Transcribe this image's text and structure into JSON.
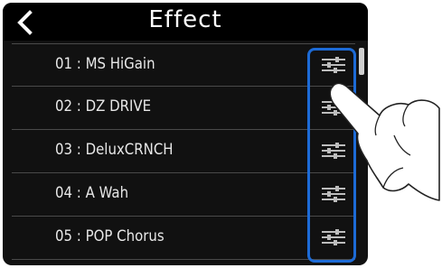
{
  "header": {
    "title": "Effect",
    "back_icon": "chevron-left-icon"
  },
  "effects": [
    {
      "number": "01",
      "name": "MS HiGain",
      "label": "01 : MS HiGain",
      "edit_icon": "sliders-icon"
    },
    {
      "number": "02",
      "name": "DZ DRIVE",
      "label": "02 : DZ DRIVE",
      "edit_icon": "sliders-icon"
    },
    {
      "number": "03",
      "name": "DeluxCRNCH",
      "label": "03 : DeluxCRNCH",
      "edit_icon": "sliders-icon"
    },
    {
      "number": "04",
      "name": "A Wah",
      "label": "04 : A Wah",
      "edit_icon": "sliders-icon"
    },
    {
      "number": "05",
      "name": "POP Chorus",
      "label": "05 : POP Chorus",
      "edit_icon": "sliders-icon"
    }
  ],
  "colors": {
    "screen_background": "#111111",
    "header_background": "#000000",
    "text": "#e8e8e8",
    "highlight": "#1d6bd6",
    "divider": "#4a4a4a"
  },
  "annotation": {
    "hand_icon": "tapping-hand-icon",
    "highlight": "edit-buttons-column"
  }
}
